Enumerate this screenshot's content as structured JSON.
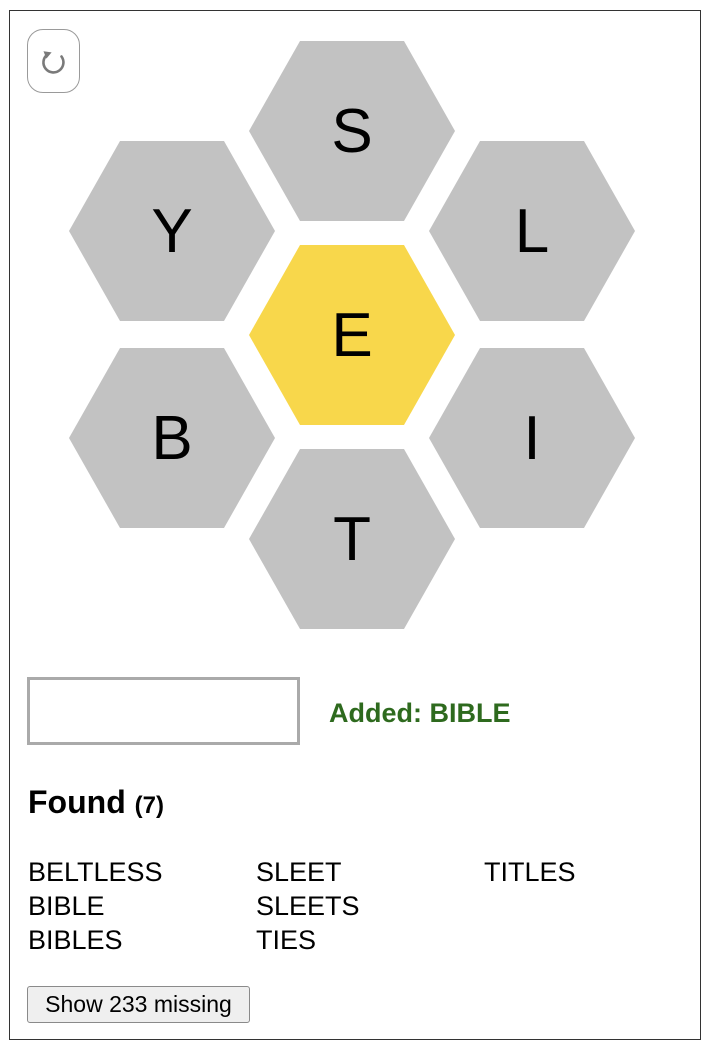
{
  "shuffle": {
    "icon": "rotate-arrow-icon",
    "glyph": "↻"
  },
  "hive": {
    "center": {
      "letter": "E",
      "color": "#f8d74b"
    },
    "outer_color": "#c2c2c2",
    "outer": [
      {
        "id": "top",
        "letter": "S"
      },
      {
        "id": "upper-left",
        "letter": "Y"
      },
      {
        "id": "upper-right",
        "letter": "L"
      },
      {
        "id": "lower-left",
        "letter": "B"
      },
      {
        "id": "lower-right",
        "letter": "I"
      },
      {
        "id": "bottom",
        "letter": "T"
      }
    ]
  },
  "input": {
    "value": "",
    "placeholder": ""
  },
  "status": {
    "text": "Added: BIBLE",
    "color": "#2e6a1e"
  },
  "found": {
    "label": "Found",
    "count_text": "(7)",
    "words": [
      "BELTLESS",
      "BIBLE",
      "BIBLES",
      "SLEET",
      "SLEETS",
      "TIES",
      "TITLES"
    ]
  },
  "show_missing": {
    "label": "Show 233 missing"
  }
}
